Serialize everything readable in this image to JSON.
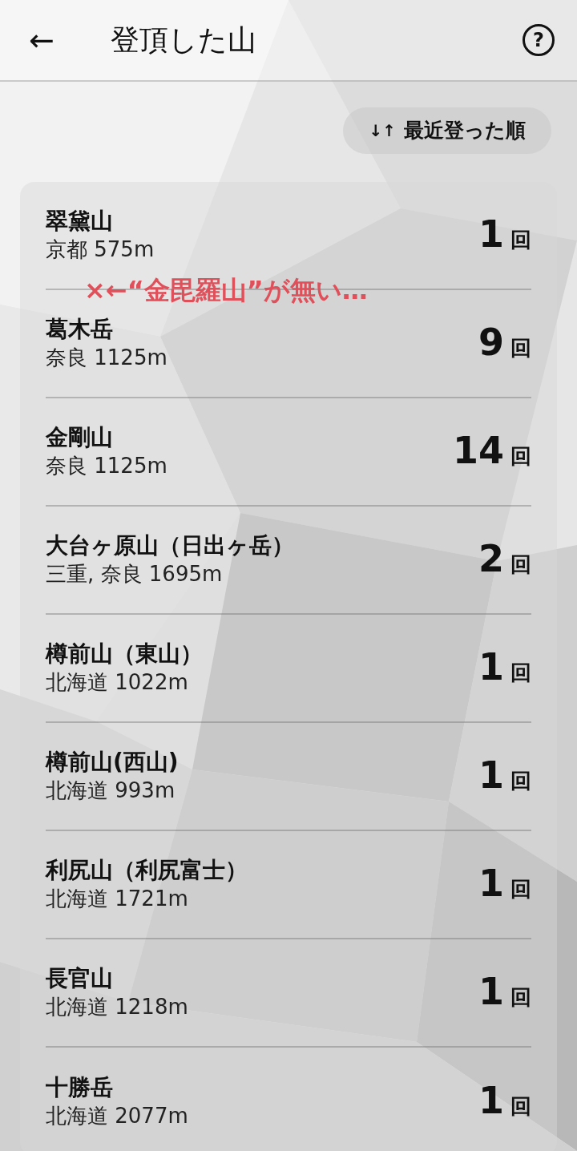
{
  "header": {
    "back": "←",
    "title": "登頂した山",
    "help": "?"
  },
  "sort": {
    "icon": "↓↑",
    "label": "最近登った順"
  },
  "annotation": {
    "text": "×←“金毘羅山”が無い…",
    "color": "#e0505a"
  },
  "mountains": [
    {
      "name": "翠黛山",
      "place": "京都 575m",
      "count": "1",
      "unit": "回"
    },
    {
      "name": "葛木岳",
      "place": "奈良 1125m",
      "count": "9",
      "unit": "回"
    },
    {
      "name": "金剛山",
      "place": "奈良 1125m",
      "count": "14",
      "unit": "回"
    },
    {
      "name": "大台ヶ原山（日出ヶ岳）",
      "place": "三重, 奈良 1695m",
      "count": "2",
      "unit": "回"
    },
    {
      "name": "樽前山（東山）",
      "place": "北海道 1022m",
      "count": "1",
      "unit": "回"
    },
    {
      "name": "樽前山(西山)",
      "place": "北海道 993m",
      "count": "1",
      "unit": "回"
    },
    {
      "name": "利尻山（利尻富士）",
      "place": "北海道 1721m",
      "count": "1",
      "unit": "回"
    },
    {
      "name": "長官山",
      "place": "北海道 1218m",
      "count": "1",
      "unit": "回"
    },
    {
      "name": "十勝岳",
      "place": "北海道 2077m",
      "count": "1",
      "unit": "回"
    }
  ]
}
